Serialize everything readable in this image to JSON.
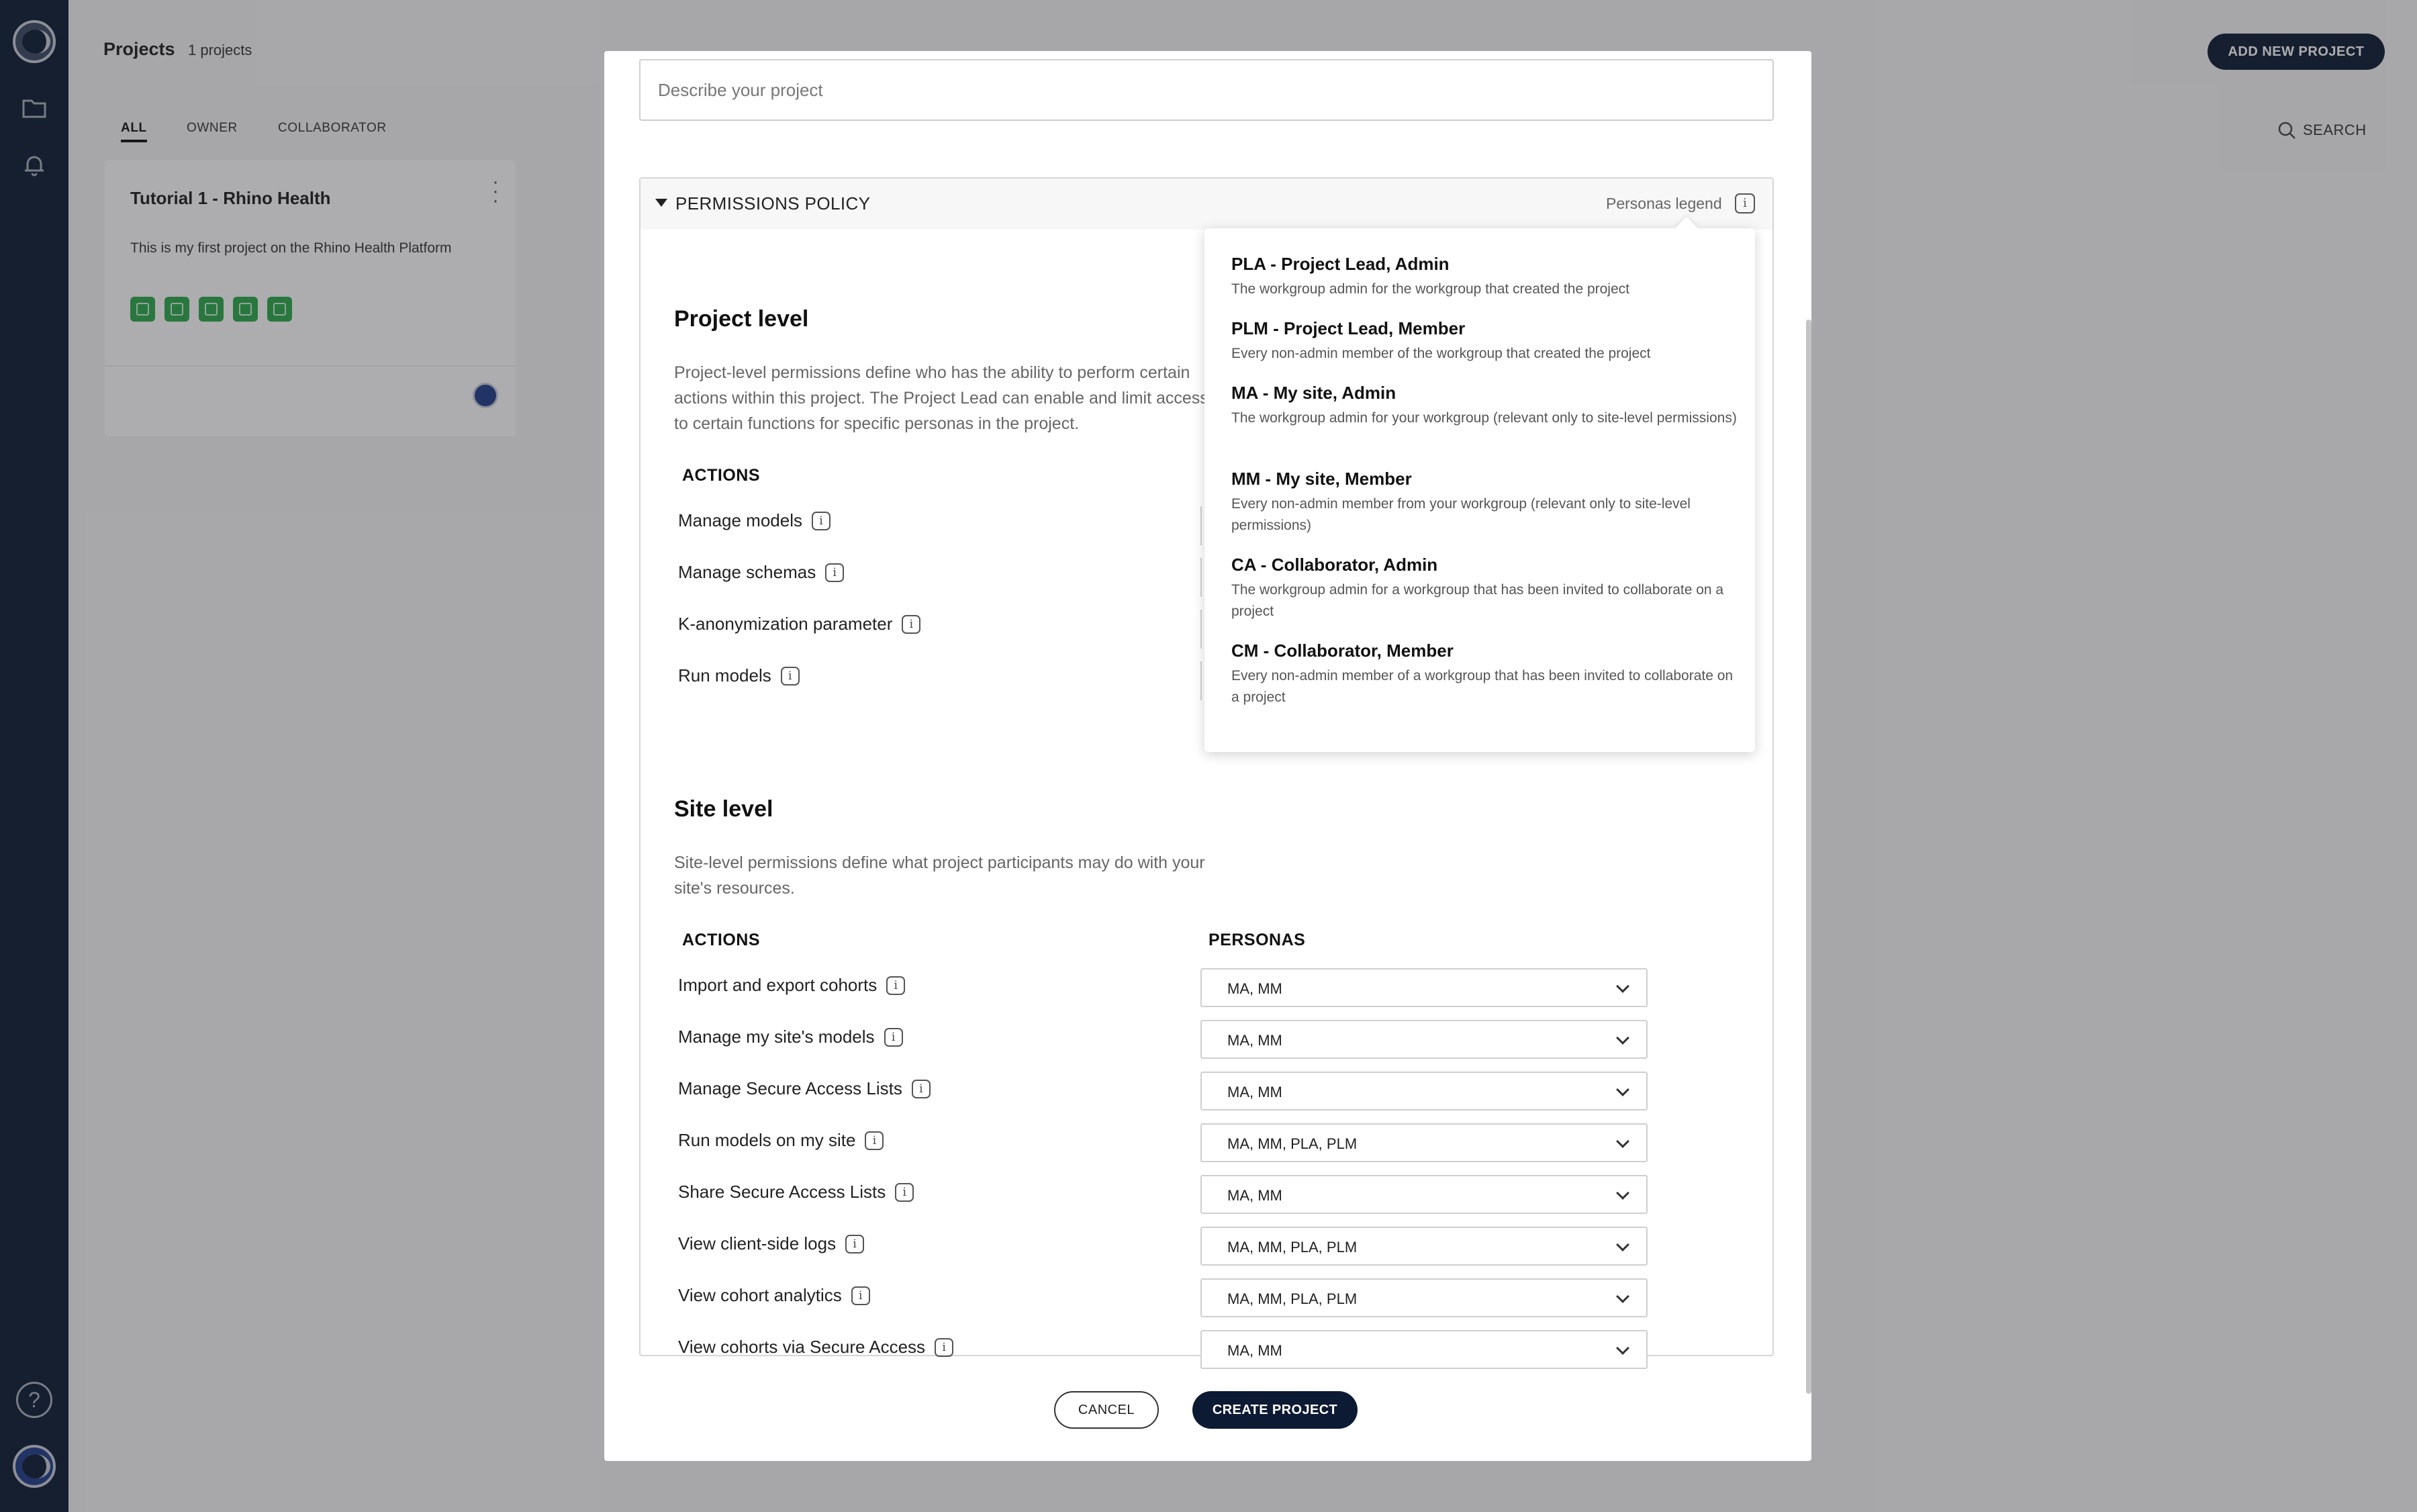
{
  "app": {
    "page_title": "Projects",
    "project_count": "1 projects",
    "add_button": "ADD NEW PROJECT",
    "search_label": "SEARCH",
    "filters": [
      "ALL",
      "OWNER",
      "COLLABORATOR"
    ]
  },
  "project_card": {
    "title": "Tutorial 1 - Rhino Health",
    "description": "This is my first project on the Rhino Health Platform"
  },
  "modal": {
    "describe_placeholder": "Describe your project",
    "permissions_title": "PERMISSIONS POLICY",
    "legend_label": "Personas legend",
    "project_level": {
      "title": "Project level",
      "description": "Project-level permissions define who has the ability to perform certain actions within this project. The Project Lead can enable and limit access to certain functions for specific personas in the project.",
      "actions_header": "ACTIONS",
      "actions": [
        "Manage models",
        "Manage schemas",
        "K-anonymization parameter",
        "Run models"
      ]
    },
    "site_level": {
      "title": "Site level",
      "description": "Site-level permissions define what project participants may do with your site's resources.",
      "actions_header": "ACTIONS",
      "personas_header": "PERSONAS",
      "rows": [
        {
          "action": "Import and export cohorts",
          "personas": "MA, MM"
        },
        {
          "action": "Manage my site's models",
          "personas": "MA, MM"
        },
        {
          "action": "Manage Secure Access Lists",
          "personas": "MA, MM"
        },
        {
          "action": "Run models on my site",
          "personas": "MA, MM, PLA, PLM"
        },
        {
          "action": "Share Secure Access Lists",
          "personas": "MA, MM"
        },
        {
          "action": "View client-side logs",
          "personas": "MA, MM, PLA, PLM"
        },
        {
          "action": "View cohort analytics",
          "personas": "MA, MM, PLA, PLM"
        },
        {
          "action": "View cohorts via Secure Access",
          "personas": "MA, MM"
        }
      ]
    },
    "cancel_button": "CANCEL",
    "create_button": "CREATE PROJECT"
  },
  "legend": [
    {
      "name": "PLA - Project Lead, Admin",
      "desc": "The workgroup admin for the workgroup that created the project"
    },
    {
      "name": "PLM - Project Lead, Member",
      "desc": "Every non-admin member of the workgroup that created the project"
    },
    {
      "name": "MA - My site, Admin",
      "desc": "The workgroup admin for your workgroup (relevant only to site-level permissions)"
    },
    {
      "name": "MM - My site, Member",
      "desc": "Every non-admin member from your workgroup (relevant only to site-level permissions)"
    },
    {
      "name": "CA - Collaborator, Admin",
      "desc": "The workgroup admin for a workgroup that has been invited to collaborate on a project"
    },
    {
      "name": "CM - Collaborator, Member",
      "desc": "Every non-admin member of a workgroup that has been invited to collaborate on a project"
    }
  ],
  "icons": {
    "info": "i",
    "help": "?"
  }
}
